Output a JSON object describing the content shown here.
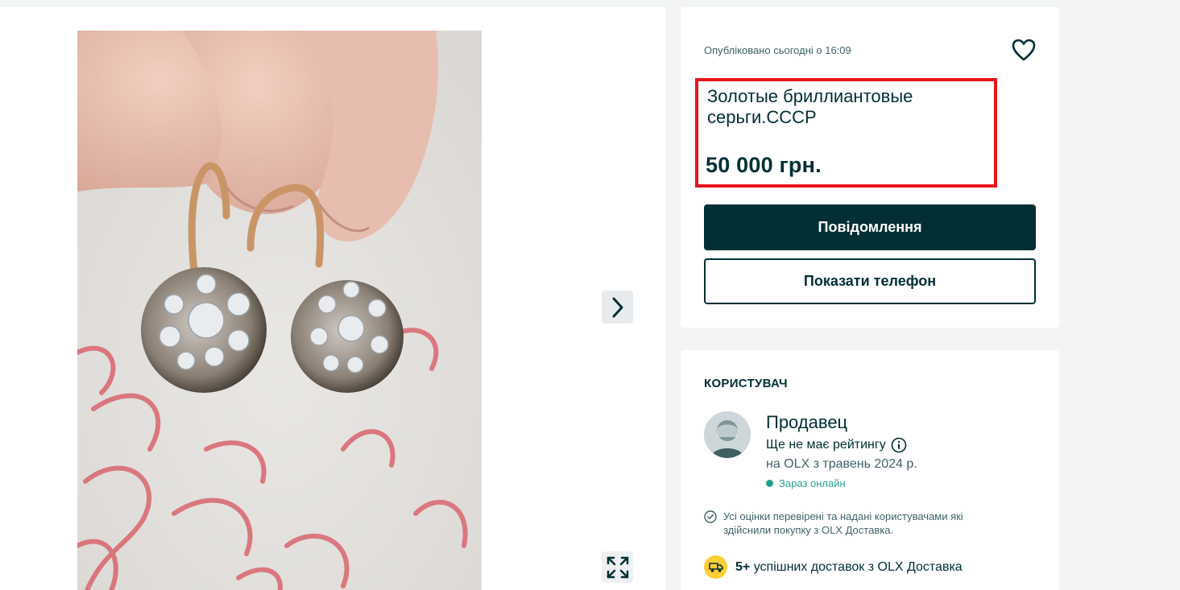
{
  "listing": {
    "posted": "Опубліковано сьогодні о 16:09",
    "title": "Золотые бриллиантовые серьги.СССР",
    "price": "50 000 грн.",
    "message_button": "Повідомлення",
    "phone_button": "Показати телефон"
  },
  "user": {
    "heading": "КОРИСТУВАЧ",
    "name": "Продавец",
    "rating": "Ще не має рейтингу",
    "since": "на OLX з травень 2024 р.",
    "status": "Зараз онлайн",
    "verified_note": "Усі оцінки перевірені та надані користувачами які здійснили покупку з OLX Доставка.",
    "delivery_count": "5+",
    "delivery_text": "успішних доставок з OLX Доставка"
  },
  "colors": {
    "primary": "#002f34",
    "highlight_border": "#e8141b",
    "online": "#23a08f",
    "delivery_badge": "#ffce32"
  },
  "icons": {
    "favorite": "heart-icon",
    "next": "chevron-right-icon",
    "fullscreen": "expand-icon",
    "info": "info-icon",
    "verified": "check-circle-icon",
    "delivery": "truck-icon"
  }
}
